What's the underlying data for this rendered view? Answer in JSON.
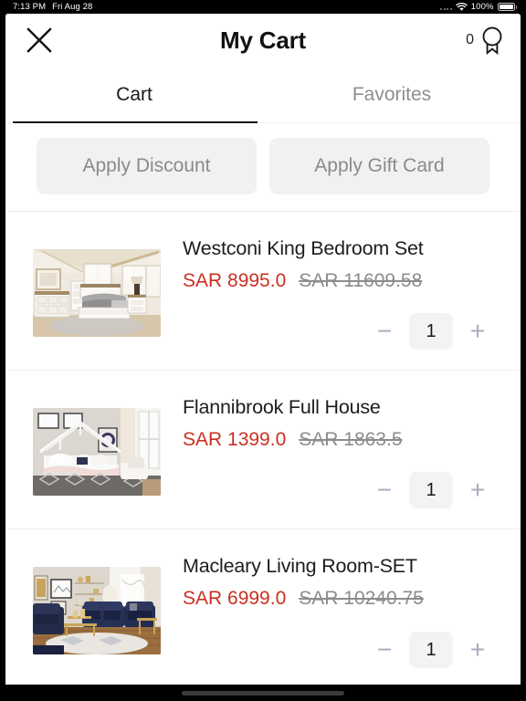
{
  "status_bar": {
    "time": "7:13 PM",
    "date": "Fri Aug 28",
    "battery_percent": "100%",
    "wifi_icon": "wifi-icon",
    "cellular_icon": "cellular-dots-icon",
    "battery_icon": "battery-full-icon"
  },
  "navbar": {
    "close_icon": "close-x-icon",
    "title": "My Cart",
    "badge_count": "0",
    "badge_icon": "award-ribbon-icon"
  },
  "tabs": [
    {
      "label": "Cart",
      "active": true
    },
    {
      "label": "Favorites",
      "active": false
    }
  ],
  "coupons": [
    {
      "label": "Apply Discount",
      "name": "apply-discount-button"
    },
    {
      "label": "Apply Gift Card",
      "name": "apply-gift-card-button"
    }
  ],
  "cart_items": [
    {
      "name": "Westconi King Bedroom Set",
      "price_now": "SAR 8995.0",
      "price_was": "SAR 11609.58",
      "quantity": "1",
      "image_alt": "white-bedroom-set-photo",
      "decrement_label": "−",
      "increment_label": "+"
    },
    {
      "name": "Flannibrook Full House",
      "price_now": "SAR 1399.0",
      "price_was": "SAR 1863.5",
      "quantity": "1",
      "image_alt": "white-house-frame-bed-photo",
      "decrement_label": "−",
      "increment_label": "+"
    },
    {
      "name": "Macleary Living Room-SET",
      "price_now": "SAR 6999.0",
      "price_was": "SAR 10240.75",
      "quantity": "1",
      "image_alt": "navy-blue-living-room-set-photo",
      "decrement_label": "−",
      "increment_label": "+"
    }
  ],
  "colors": {
    "price_red": "#cc2f21",
    "price_strike_gray": "#8c8c8c",
    "tab_inactive": "#8e8e8e",
    "coupon_bg": "#f1f1f1",
    "stepper_blue_gray": "#a7aec0"
  }
}
